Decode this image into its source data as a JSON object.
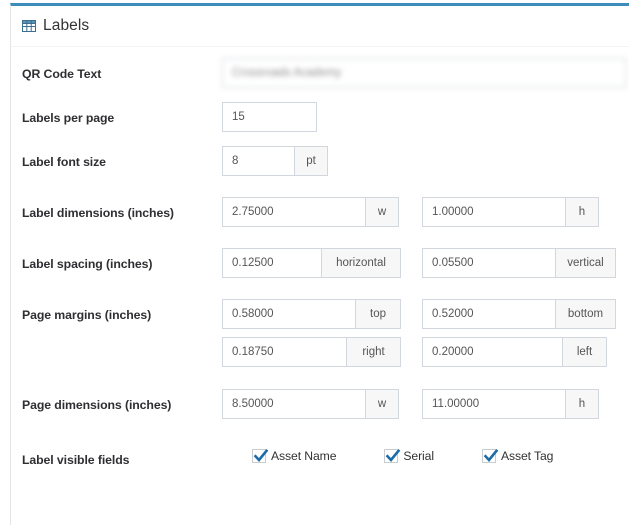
{
  "panel": {
    "title": "Labels",
    "icon": "table-grid-icon",
    "accent_color": "#3c8dbc",
    "border_color": "#d2d6de",
    "addon_background": "#f7f7f7",
    "checkbox_color": "#1b6ca8"
  },
  "fields": {
    "qr_code_text": {
      "label": "QR Code Text",
      "value": "Crossroads Academy",
      "redacted": true
    },
    "labels_per_page": {
      "label": "Labels per page",
      "value": "15"
    },
    "label_font_size": {
      "label": "Label font size",
      "value": "8",
      "unit": "pt"
    },
    "label_dimensions": {
      "label": "Label dimensions (inches)",
      "width": {
        "value": "2.75000",
        "unit": "w"
      },
      "height": {
        "value": "1.00000",
        "unit": "h"
      }
    },
    "label_spacing": {
      "label": "Label spacing (inches)",
      "horizontal": {
        "value": "0.12500",
        "unit": "horizontal"
      },
      "vertical": {
        "value": "0.05500",
        "unit": "vertical"
      }
    },
    "page_margins": {
      "label": "Page margins (inches)",
      "top": {
        "value": "0.58000",
        "unit": "top"
      },
      "bottom": {
        "value": "0.52000",
        "unit": "bottom"
      },
      "right": {
        "value": "0.18750",
        "unit": "right"
      },
      "left": {
        "value": "0.20000",
        "unit": "left"
      }
    },
    "page_dimensions": {
      "label": "Page dimensions (inches)",
      "width": {
        "value": "8.50000",
        "unit": "w"
      },
      "height": {
        "value": "11.00000",
        "unit": "h"
      }
    },
    "label_visible_fields": {
      "label": "Label visible fields",
      "options": [
        {
          "label": "Asset Name",
          "checked": true
        },
        {
          "label": "Serial",
          "checked": true
        },
        {
          "label": "Asset Tag",
          "checked": true
        }
      ]
    }
  }
}
